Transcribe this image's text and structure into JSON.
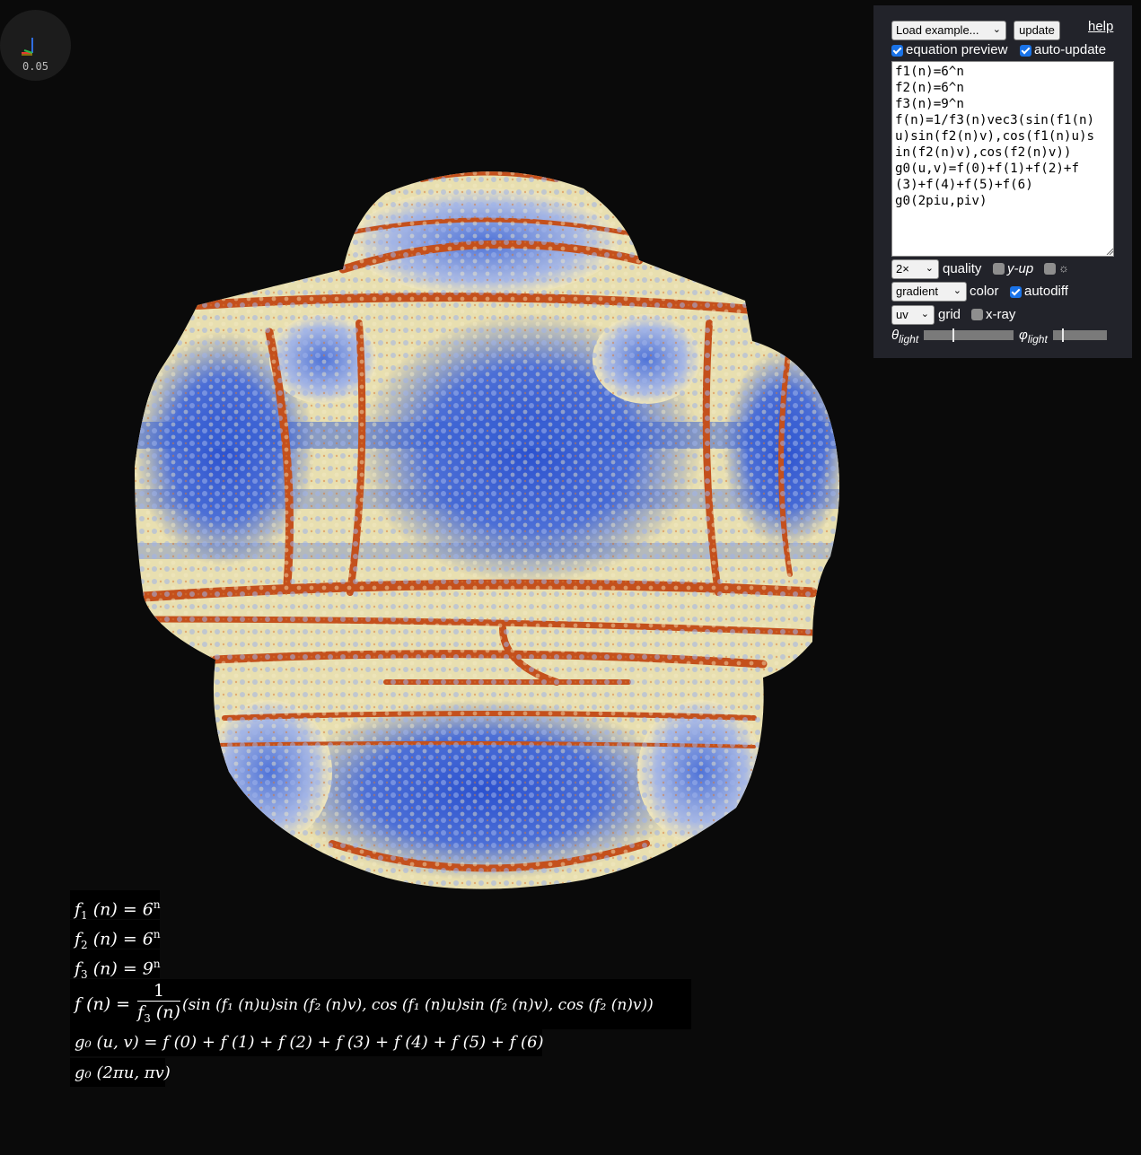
{
  "axis_widget": {
    "scale": "0.05"
  },
  "panel": {
    "example_select": "Load example...",
    "update_button": "update",
    "help_link": "help",
    "equation_preview_label": "equation preview",
    "equation_preview_checked": true,
    "auto_update_label": "auto-update",
    "auto_update_checked": true,
    "code": "f1(n)=6^n\nf2(n)=6^n\nf3(n)=9^n\nf(n)=1/f3(n)vec3(sin(f1(n)\nu)sin(f2(n)v),cos(f1(n)u)s\nin(f2(n)v),cos(f2(n)v))\ng0(u,v)=f(0)+f(1)+f(2)+f\n(3)+f(4)+f(5)+f(6)\ng0(2piu,piv)",
    "quality_select": "2×",
    "quality_label": "quality",
    "yup_label": "y-up",
    "yup_checked": false,
    "sun_label": "☼",
    "sun_checked": false,
    "color_select": "gradient",
    "color_label": "color",
    "autodiff_label": "autodiff",
    "autodiff_checked": true,
    "grid_select": "uv",
    "grid_label": "grid",
    "xray_label": "x-ray",
    "xray_checked": false,
    "theta_label": "θ",
    "theta_sub": "light",
    "theta_value": 0.33,
    "phi_label": "φ",
    "phi_sub": "light",
    "phi_value": 0.18
  },
  "equations": {
    "l1_lhs": "f",
    "l1_sub": "1",
    "l1_mid": " (n) = 6",
    "l1_sup": "n",
    "l2_lhs": "f",
    "l2_sub": "2",
    "l2_mid": " (n) = 6",
    "l2_sup": "n",
    "l3_lhs": "f",
    "l3_sub": "3",
    "l3_mid": " (n) = 9",
    "l3_sup": "n",
    "l4_lhs": "f (n) = ",
    "l4_num": "1",
    "l4_den": "f",
    "l4_den_sub": "3",
    "l4_den_tail": " (n)",
    "l4_rhs": "(sin (f₁ (n)u)sin (f₂ (n)v), cos (f₁ (n)u)sin (f₂ (n)v), cos (f₂ (n)v))",
    "l5": "g₀ (u, v) = f (0) + f (1) + f (2) + f (3) + f (4) + f (5) + f (6)",
    "l6": "g₀ (2πu, πv)"
  },
  "colors": {
    "background": "#0a0a0a",
    "panel": "#22232a",
    "surface_blue": "#2f57c8",
    "surface_cream": "#e8dfb0",
    "surface_orange": "#c8561d"
  }
}
